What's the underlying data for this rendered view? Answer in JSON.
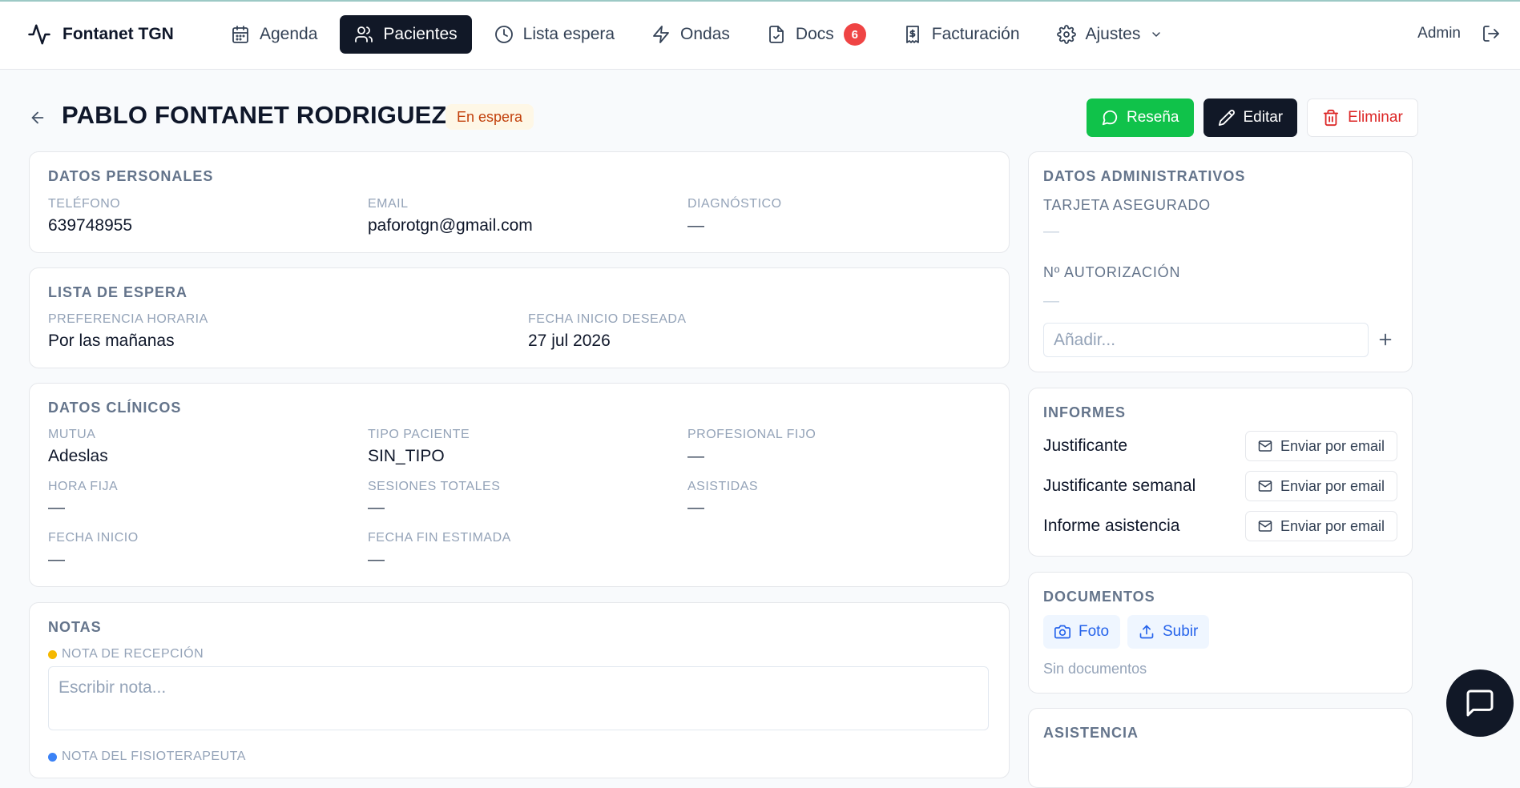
{
  "app": {
    "name": "Fontanet TGN"
  },
  "nav": {
    "items": [
      {
        "label": "Agenda",
        "icon": "calendar-icon"
      },
      {
        "label": "Pacientes",
        "icon": "users-icon",
        "active": true
      },
      {
        "label": "Lista espera",
        "icon": "clock-icon"
      },
      {
        "label": "Ondas",
        "icon": "zap-icon"
      },
      {
        "label": "Docs",
        "icon": "file-check-icon",
        "badge": "6"
      },
      {
        "label": "Facturación",
        "icon": "receipt-icon"
      },
      {
        "label": "Ajustes",
        "icon": "gear-icon"
      }
    ],
    "user": "Admin"
  },
  "patient": {
    "name": "PABLO FONTANET RODRIGUEZ",
    "status": "En espera"
  },
  "actions": {
    "review": "Reseña",
    "edit": "Editar",
    "delete": "Eliminar"
  },
  "personal": {
    "title": "DATOS PERSONALES",
    "phone_label": "TELÉFONO",
    "phone": "639748955",
    "email_label": "EMAIL",
    "email": "paforotgn@gmail.com",
    "diagnosis_label": "DIAGNÓSTICO",
    "diagnosis": "—"
  },
  "waitlist": {
    "title": "LISTA DE ESPERA",
    "pref_label": "PREFERENCIA HORARIA",
    "pref": "Por las mañanas",
    "start_label": "FECHA INICIO DESEADA",
    "start": "27 jul 2026"
  },
  "clinical": {
    "title": "DATOS CLÍNICOS",
    "mutua_label": "MUTUA",
    "mutua": "Adeslas",
    "tipo_label": "TIPO PACIENTE",
    "tipo": "SIN_TIPO",
    "prof_label": "PROFESIONAL FIJO",
    "prof": "—",
    "hora_label": "HORA FIJA",
    "hora": "—",
    "sesiones_label": "SESIONES TOTALES",
    "sesiones": "—",
    "asistidas_label": "ASISTIDAS",
    "asistidas": "—",
    "inicio_label": "FECHA INICIO",
    "inicio": "—",
    "fin_label": "FECHA FIN ESTIMADA",
    "fin": "—"
  },
  "notes": {
    "title": "NOTAS",
    "reception_label": "NOTA DE RECEPCIÓN",
    "reception_placeholder": "Escribir nota...",
    "physio_label": "NOTA DEL FISIOTERAPEUTA",
    "colors": {
      "reception": "#f5b800",
      "physio": "#3b82f6"
    }
  },
  "admin": {
    "title": "DATOS ADMINISTRATIVOS",
    "card_label": "TARJETA ASEGURADO",
    "card": "—",
    "auth_label": "Nº AUTORIZACIÓN",
    "auth": "—",
    "add_placeholder": "Añadir..."
  },
  "reports": {
    "title": "INFORMES",
    "send_label": "Enviar por email",
    "items": [
      "Justificante",
      "Justificante semanal",
      "Informe asistencia"
    ]
  },
  "documents": {
    "title": "DOCUMENTOS",
    "photo": "Foto",
    "upload": "Subir",
    "empty": "Sin documentos"
  },
  "attendance": {
    "title": "ASISTENCIA"
  }
}
